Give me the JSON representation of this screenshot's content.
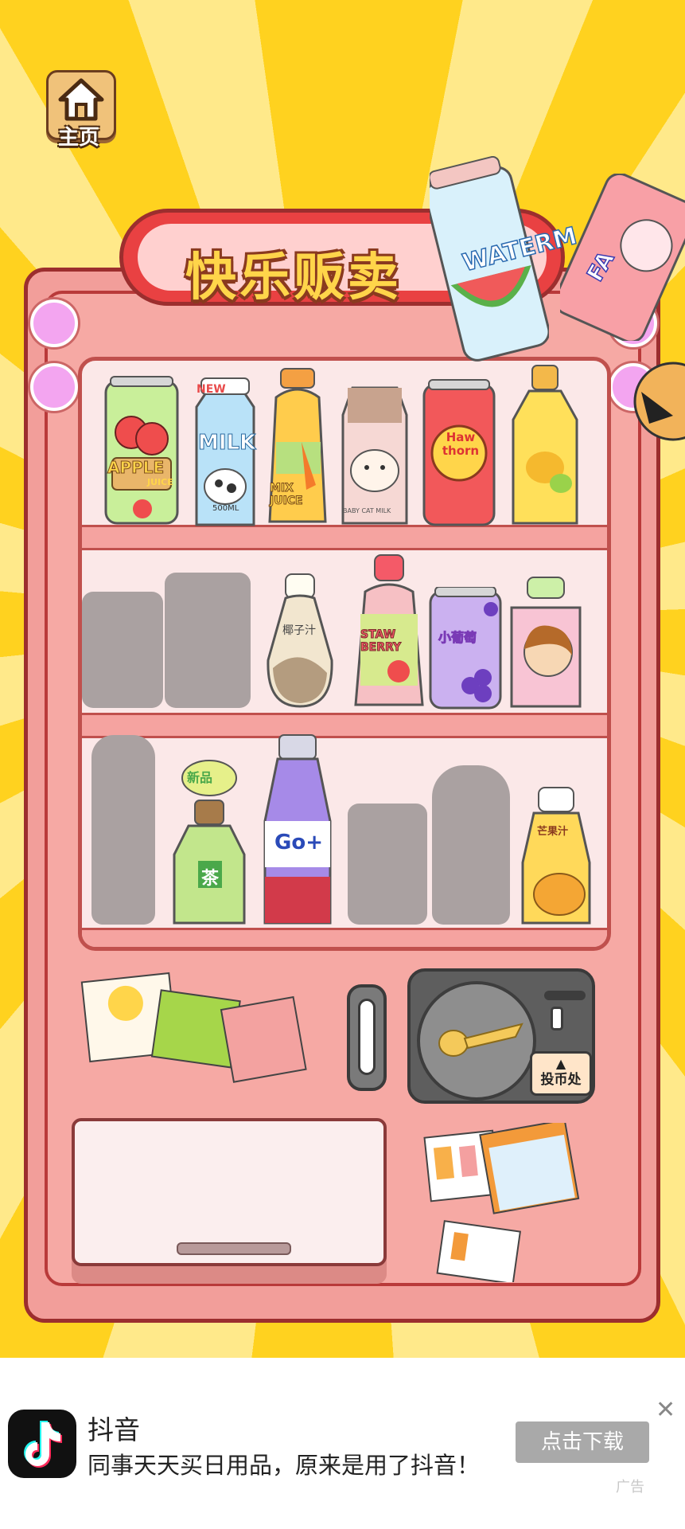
{
  "home": {
    "label": "主页"
  },
  "machine": {
    "title": "快乐贩卖",
    "coin_label": "投币处"
  },
  "drinks": {
    "row1": [
      "APPLE",
      "MILK",
      "MIX JUICE",
      "BABY CAT MILK",
      "Haw thorn",
      "lemon"
    ],
    "row2": [
      "椰子汁",
      "STAW BERRY",
      "小葡萄",
      "girl"
    ],
    "row3": [
      "茶",
      "Go+",
      "芒果汁"
    ],
    "flying": [
      "WATERM",
      "FA"
    ],
    "new_tag": "NEW",
    "new_item": "新品",
    "milk_volume": "500ML",
    "apple_sub": "JUICE"
  },
  "ad": {
    "app_name": "抖音",
    "description": "同事天天买日用品，原来是用了抖音！",
    "button_label": "点击下载",
    "close_glyph": "✕",
    "tag": "广告"
  }
}
